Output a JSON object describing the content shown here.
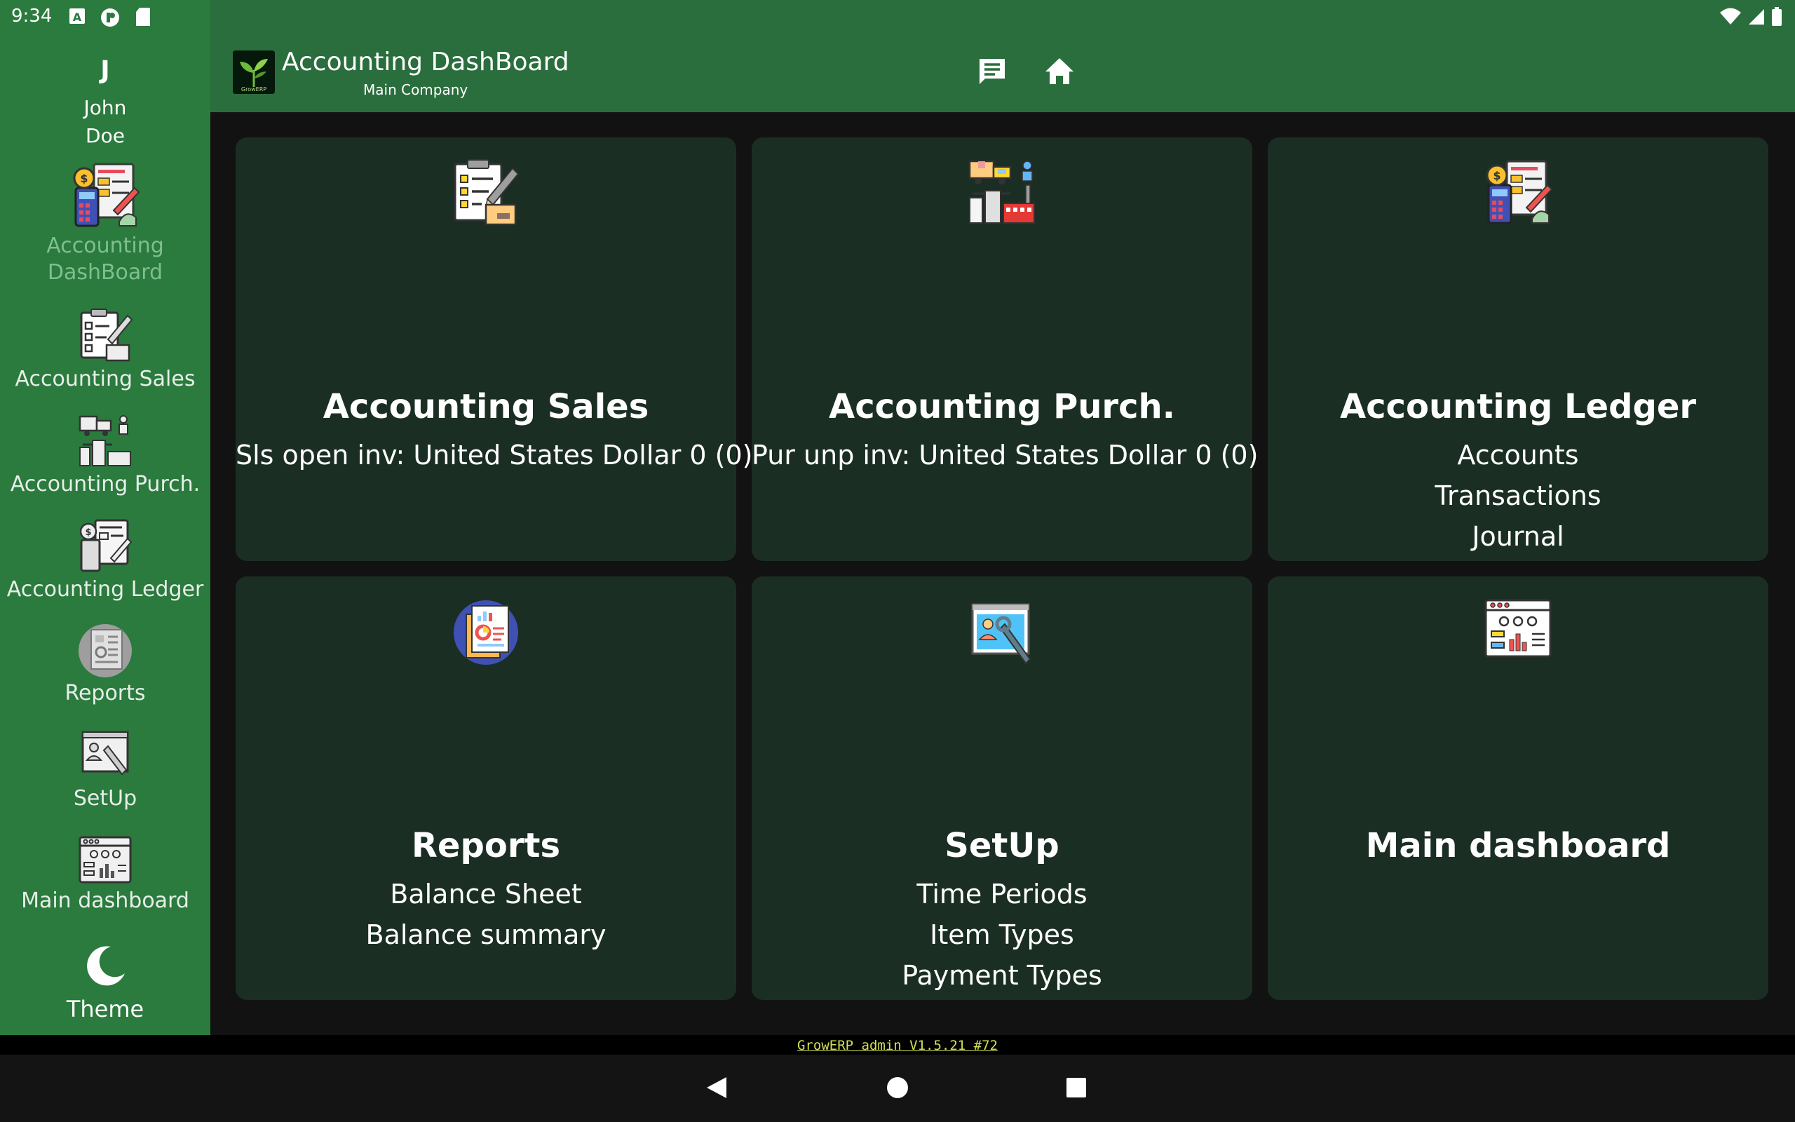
{
  "status_bar": {
    "time": "9:34",
    "icons": [
      "notification-a-icon",
      "app-icon",
      "sd-card-icon",
      "wifi-icon",
      "signal-icon",
      "battery-icon"
    ]
  },
  "user": {
    "initial": "J",
    "first_name": "John",
    "last_name": "Doe"
  },
  "sidebar": {
    "items": [
      {
        "label": "Accounting DashBoard",
        "icon": "accounting-dashboard-icon",
        "active": true
      },
      {
        "label": "Accounting Sales",
        "icon": "accounting-sales-icon"
      },
      {
        "label": "Accounting Purch.",
        "icon": "accounting-purchase-icon"
      },
      {
        "label": "Accounting Ledger",
        "icon": "accounting-ledger-icon"
      },
      {
        "label": "Reports",
        "icon": "reports-icon"
      },
      {
        "label": "SetUp",
        "icon": "setup-icon"
      },
      {
        "label": "Main dashboard",
        "icon": "main-dashboard-icon"
      },
      {
        "label": "Theme",
        "icon": "moon-icon"
      }
    ]
  },
  "appbar": {
    "title": "Accounting DashBoard",
    "subtitle": "Main Company",
    "logo_text": "GrowERP",
    "actions": [
      "chat-icon",
      "home-icon"
    ]
  },
  "cards": [
    {
      "title": "Accounting Sales",
      "lines": [
        "Sls open inv: United States Dollar 0 (0)"
      ],
      "icon": "accounting-sales-icon"
    },
    {
      "title": "Accounting Purch.",
      "lines": [
        "Pur unp inv: United States Dollar 0 (0)"
      ],
      "icon": "accounting-purchase-icon"
    },
    {
      "title": "Accounting Ledger",
      "lines": [
        "Accounts",
        "Transactions",
        "Journal"
      ],
      "icon": "accounting-ledger-icon"
    },
    {
      "title": "Reports",
      "lines": [
        "Balance Sheet",
        "Balance summary"
      ],
      "icon": "reports-icon"
    },
    {
      "title": "SetUp",
      "lines": [
        "Time Periods",
        "Item Types",
        "Payment Types"
      ],
      "icon": "setup-icon"
    },
    {
      "title": "Main dashboard",
      "lines": [],
      "icon": "main-dashboard-icon"
    }
  ],
  "footer": {
    "version": "GrowERP admin V1.5.21 #72"
  },
  "navbar": [
    "back-icon",
    "home-circle-icon",
    "recents-icon"
  ],
  "colors": {
    "sidebar": "#2b7a3e",
    "appbar": "#2b6e3e",
    "card": "#1b2e23",
    "background": "#121212",
    "version_text": "#d4e157"
  }
}
